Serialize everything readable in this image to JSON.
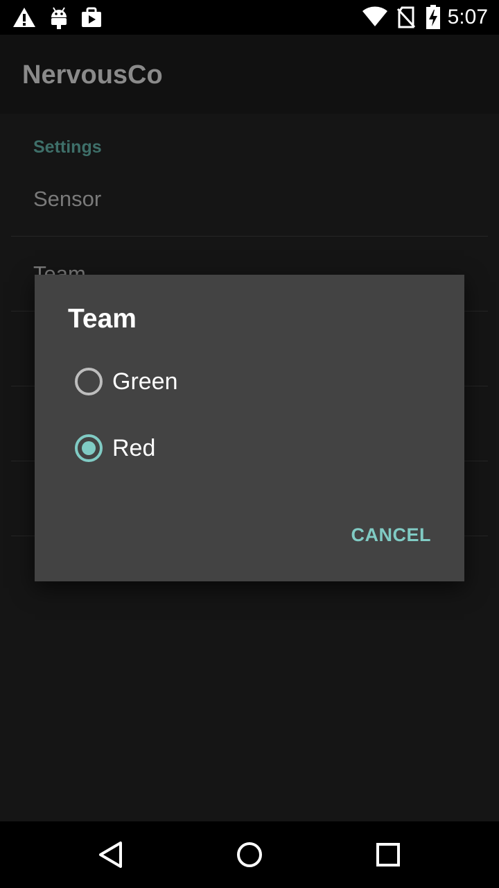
{
  "status_bar": {
    "time": "5:07",
    "icons_left": [
      "warning-icon",
      "android-debug-icon",
      "play-store-icon"
    ],
    "icons_right": [
      "wifi-icon",
      "no-sim-icon",
      "battery-charging-icon"
    ]
  },
  "app_bar": {
    "title": "NervousCo"
  },
  "settings": {
    "category_title": "Settings",
    "items": [
      {
        "label": "Sensor"
      },
      {
        "label": "Team"
      }
    ]
  },
  "dialog": {
    "title": "Team",
    "options": [
      {
        "label": "Green",
        "selected": false
      },
      {
        "label": "Red",
        "selected": true
      }
    ],
    "cancel_label": "CANCEL"
  },
  "nav_bar": {
    "buttons": [
      "back-icon",
      "home-icon",
      "recents-icon"
    ]
  },
  "colors": {
    "accent": "#80cbc4",
    "dialog_bg": "#434343",
    "background": "#151515"
  }
}
